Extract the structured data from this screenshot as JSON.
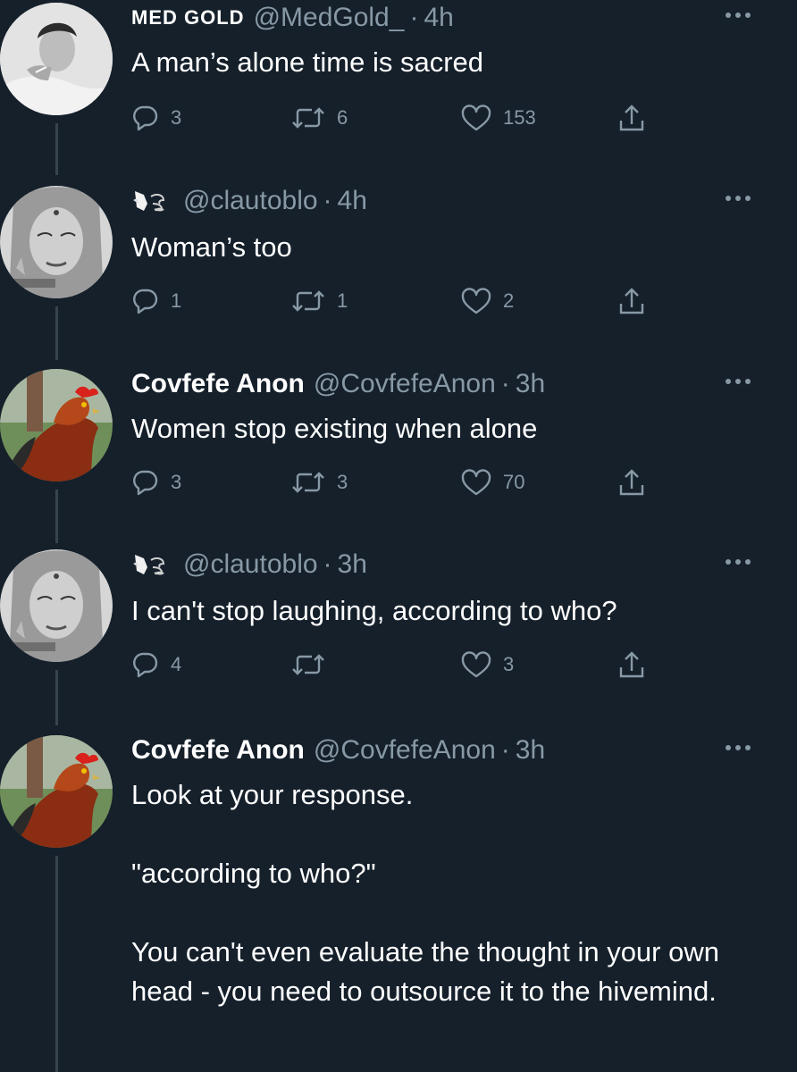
{
  "tweets": [
    {
      "name": "MED GOLD",
      "handle": "@MedGold_",
      "sep": "·",
      "time": "4h",
      "text": "A man’s alone time is sacred",
      "replies": "3",
      "retweets": "6",
      "likes": "153",
      "avatar": "man-smoking-avatar"
    },
    {
      "name": "",
      "handle": "@clautoblo",
      "sep": "·",
      "time": "4h",
      "text": "Woman’s too",
      "replies": "1",
      "retweets": "1",
      "likes": "2",
      "avatar": "woman-drawing-avatar"
    },
    {
      "name": "Covfefe Anon",
      "handle": "@CovfefeAnon",
      "sep": "·",
      "time": "3h",
      "text": "Women stop existing when alone",
      "replies": "3",
      "retweets": "3",
      "likes": "70",
      "avatar": "rooster-avatar"
    },
    {
      "name": "",
      "handle": "@clautoblo",
      "sep": "·",
      "time": "3h",
      "text": "I can't stop laughing, according to who?",
      "replies": "4",
      "retweets": "",
      "likes": "3",
      "avatar": "woman-drawing-avatar"
    },
    {
      "name": "Covfefe Anon",
      "handle": "@CovfefeAnon",
      "sep": "·",
      "time": "3h",
      "text": "Look at your response.\n\n\"according to who?\"\n\nYou can't even evaluate the thought in your own head - you need to outsource it to the hivemind.",
      "avatar": "rooster-avatar"
    }
  ],
  "colors": {
    "background": "#15202b",
    "text": "#ffffff",
    "secondary": "#8899a6",
    "thread_line": "#38444d"
  },
  "icons": [
    "reply-icon",
    "retweet-icon",
    "like-icon",
    "share-icon",
    "more-options-icon",
    "pointing-hand-emoji",
    "dash-emoji"
  ]
}
